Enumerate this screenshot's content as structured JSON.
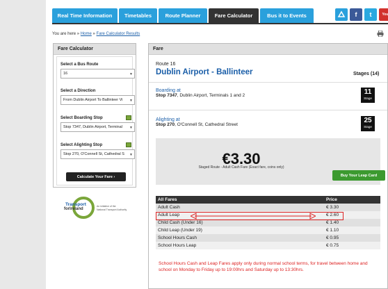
{
  "nav": {
    "tabs": [
      "Real Time Information",
      "Timetables",
      "Route Planner",
      "Fare Calculator",
      "Bus it to Events"
    ],
    "active": "Fare Calculator"
  },
  "social": [
    "transport-icon",
    "facebook-icon",
    "twitter-icon",
    "youtube-icon"
  ],
  "breadcrumb": {
    "prefix": "You are here »",
    "home": "Home",
    "sep": "»",
    "current": "Fare Calculator Results"
  },
  "sidebar": {
    "title": "Fare Calculator",
    "route_label": "Select a Bus Route",
    "route_value": "16",
    "direction_label": "Select a Direction",
    "direction_value": "From Dublin Airport To Ballinteer Vi",
    "boarding_label": "Select Boarding Stop",
    "boarding_value": "Stop 7347, Dublin Airport, Terminal",
    "alighting_label": "Select Alighting Stop",
    "alighting_value": "Stop 270, O'Connell St, Cathedral S",
    "button": "Calculate Your Fare ›"
  },
  "logo": {
    "line1": "Transport",
    "line2": "forIreland",
    "tagline1": "An initiative of the",
    "tagline2": "National Transport Authority"
  },
  "fare": {
    "title": "Fare",
    "route_label": "Route 16",
    "route_name": "Dublin Airport - Ballinteer",
    "stages": "Stages (14)",
    "boarding": {
      "label": "Boarding at",
      "stop": "Stop 7347",
      "desc": ", Dublin Airport, Terminals 1 and 2",
      "stage": "11",
      "stage_word": "Stage"
    },
    "alighting": {
      "label": "Alighting at",
      "stop": "Stop 270",
      "desc": ", O'Connell St, Cathedral Street",
      "stage": "25",
      "stage_word": "Stage"
    },
    "price": "€3.30",
    "price_note": "Staged Route - Adult Cash Fare (Exact fare, coins only)",
    "leap_button": "Buy Your Leap Card"
  },
  "table": {
    "headers": [
      "All Fares",
      "Price"
    ],
    "rows": [
      [
        "Adult Cash",
        "€ 3.30"
      ],
      [
        "Adult Leap",
        "€ 2.60"
      ],
      [
        "Child Cash (Under 16)",
        "€ 1.40"
      ],
      [
        "Child Leap (Under 19)",
        "€ 1.10"
      ],
      [
        "School Hours Cash",
        "€ 0.95"
      ],
      [
        "School Hours Leap",
        "€ 0.75"
      ]
    ]
  },
  "note": "School Hours Cash and Leap Fares apply only during normal school terms, for travel between home and school on Monday to Friday up to 19:00hrs and Saturday up to 13:30hrs.",
  "colors": {
    "nav_blue": "#2aa0dc",
    "link_blue": "#1a5ea8",
    "note_red": "#d22222",
    "leap_green": "#3c9a2f"
  }
}
